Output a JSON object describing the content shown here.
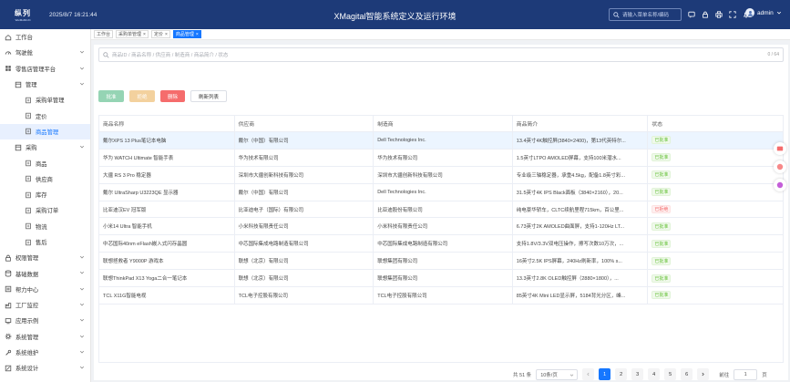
{
  "topbar": {
    "logo_text": "纵列",
    "logo_sub": "WeiMuMinXi",
    "datetime": "2025/8/7 16:21:44",
    "title": "XMagital智能系统定义及运行环境",
    "search_placeholder": "请输入菜单名称/编码",
    "user": "admin"
  },
  "sidebar": {
    "items": [
      {
        "label": "工作台",
        "icon": "home-icon",
        "level": 0
      },
      {
        "label": "驾驶舱",
        "icon": "dashboard-icon",
        "level": 0,
        "arrow": true
      },
      {
        "label": "零售店管理平台",
        "icon": "grid-icon",
        "level": 0,
        "arrow": true
      },
      {
        "label": "管理",
        "icon": "folder-icon",
        "level": 1,
        "arrow": true
      },
      {
        "label": "采购单管理",
        "icon": "doc-icon",
        "level": 2
      },
      {
        "label": "定价",
        "icon": "doc-icon",
        "level": 2
      },
      {
        "label": "商品管理",
        "icon": "doc-icon",
        "level": 2,
        "active": true
      },
      {
        "label": "采购",
        "icon": "folder-icon",
        "level": 1,
        "arrow": true
      },
      {
        "label": "商品",
        "icon": "doc-icon",
        "level": 2
      },
      {
        "label": "供应商",
        "icon": "doc-icon",
        "level": 2
      },
      {
        "label": "库存",
        "icon": "doc-icon",
        "level": 2
      },
      {
        "label": "采购订单",
        "icon": "doc-icon",
        "level": 2
      },
      {
        "label": "物流",
        "icon": "doc-icon",
        "level": 2
      },
      {
        "label": "售后",
        "icon": "doc-icon",
        "level": 2
      },
      {
        "label": "权限管理",
        "icon": "lock-icon",
        "level": 0,
        "arrow": true
      },
      {
        "label": "基础数据",
        "icon": "database-icon",
        "level": 0,
        "arrow": true
      },
      {
        "label": "帮力中心",
        "icon": "help-icon",
        "level": 0,
        "arrow": true
      },
      {
        "label": "工厂监控",
        "icon": "monitor-icon",
        "level": 0,
        "arrow": true
      },
      {
        "label": "应用示例",
        "icon": "app-icon",
        "level": 0,
        "arrow": true
      },
      {
        "label": "系统管理",
        "icon": "gear-icon",
        "level": 0,
        "arrow": true
      },
      {
        "label": "系统维护",
        "icon": "tool-icon",
        "level": 0,
        "arrow": true
      },
      {
        "label": "系统设计",
        "icon": "design-icon",
        "level": 0,
        "arrow": true
      }
    ]
  },
  "tabs": [
    {
      "label": "工作台",
      "closable": false
    },
    {
      "label": "采购单管理",
      "closable": true
    },
    {
      "label": "定价",
      "closable": true
    },
    {
      "label": "商品管理",
      "closable": true,
      "active": true
    }
  ],
  "search": {
    "placeholder": "商品ID / 商品名称 / 供应商 / 制造商 / 商品简介 / 状态",
    "counter": "0 / 64"
  },
  "buttons": {
    "add": "批准",
    "edit": "拒绝",
    "delete": "删除",
    "refresh": "刷新列表"
  },
  "table": {
    "headers": [
      "商品名称",
      "供应商",
      "制造商",
      "商品简介",
      "状态"
    ],
    "rows": [
      [
        "戴尔XPS 13 Plus笔记本电脑",
        "戴尔（中国）有限公司",
        "Dell Technologies Inc.",
        "13.4英寸4K触控屏(3840×2400)，第13代英特尔...",
        "已批准"
      ],
      [
        "华为 WATCH Ultimate 智能手表",
        "华为技术有限公司",
        "华为技术有限公司",
        "1.5英寸LTPO AMOLED屏幕，支持100米潜水...",
        "已批准"
      ],
      [
        "大疆 RS 3 Pro 稳定器",
        "深圳市大疆创新科技有限公司",
        "深圳市大疆创新科技有限公司",
        "专业级三轴稳定器，承重4.5kg，配备1.8英寸彩...",
        "已批准"
      ],
      [
        "戴尔 UltraSharp U3223QE 显示器",
        "戴尔（中国）有限公司",
        "Dell Technologies Inc.",
        "31.5英寸4K IPS Black面板（3840×2160），20...",
        "已批准"
      ],
      [
        "比亚迪汉EV 冠军版",
        "比亚迪电子（国际）有限公司",
        "比亚迪股份有限公司",
        "纯电豪华轿车，CLTC续航里程715km，百公里...",
        "已拒绝"
      ],
      [
        "小米14 Ultra 智能手机",
        "小米科技有限责任公司",
        "小米科技有限责任公司",
        "6.73英寸2K AMOLED曲面屏，支持1-120Hz LT...",
        "已批准"
      ],
      [
        "中芯国际40nm eFlash嵌入式闪存晶圆",
        "中芯国际集成电路制造有限公司",
        "中芯国际集成电路制造有限公司",
        "支持1.8V/3.3V双电压操作，擦写次数10万次，...",
        "已批准"
      ],
      [
        "联想拯救者 Y9000P 游戏本",
        "联想（北京）有限公司",
        "联想集团有限公司",
        "16英寸2.5K IPS屏幕，240Hz刷新率，100% s...",
        "已批准"
      ],
      [
        "联想ThinkPad X13 Yoga二合一笔记本",
        "联想（北京）有限公司",
        "联想集团有限公司",
        "13.3英寸2.8K OLED触控屏（2880×1800），...",
        "已批准"
      ],
      [
        "TCL X11G智能电视",
        "TCL电子控股有限公司",
        "TCL电子控股有限公司",
        "85英寸4K Mini LED显示屏，5184背光分区，峰...",
        "已批准"
      ]
    ],
    "selected_row": 0
  },
  "pager": {
    "total": "共 51 条",
    "page_size": "10条/页",
    "pages": [
      "1",
      "2",
      "3",
      "4",
      "5",
      "6"
    ],
    "current": "1",
    "goto_label": "前往",
    "goto_value": "1",
    "page_suffix": "页"
  }
}
